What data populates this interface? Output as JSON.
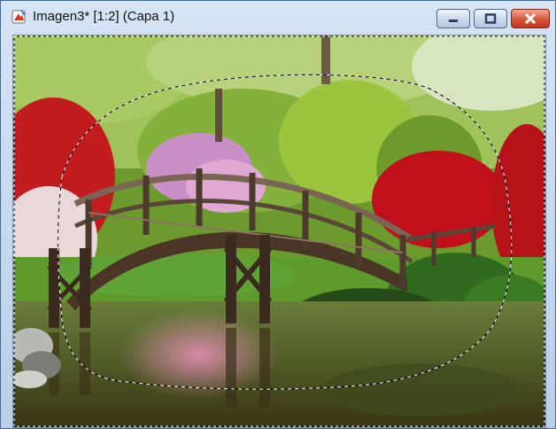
{
  "window": {
    "title": "Imagen3* [1:2] (Capa 1)",
    "app_icon": "paint-palette-icon",
    "controls": {
      "minimize": "minimize-icon",
      "maximize": "maximize-icon",
      "close": "close-icon"
    }
  },
  "canvas": {
    "image_subject": "photo-canvas",
    "selection": "marquee-selection"
  },
  "colors": {
    "title_bar": "#c9dbf0",
    "close_button": "#d24a32",
    "selection_stroke": "#ffffff"
  }
}
